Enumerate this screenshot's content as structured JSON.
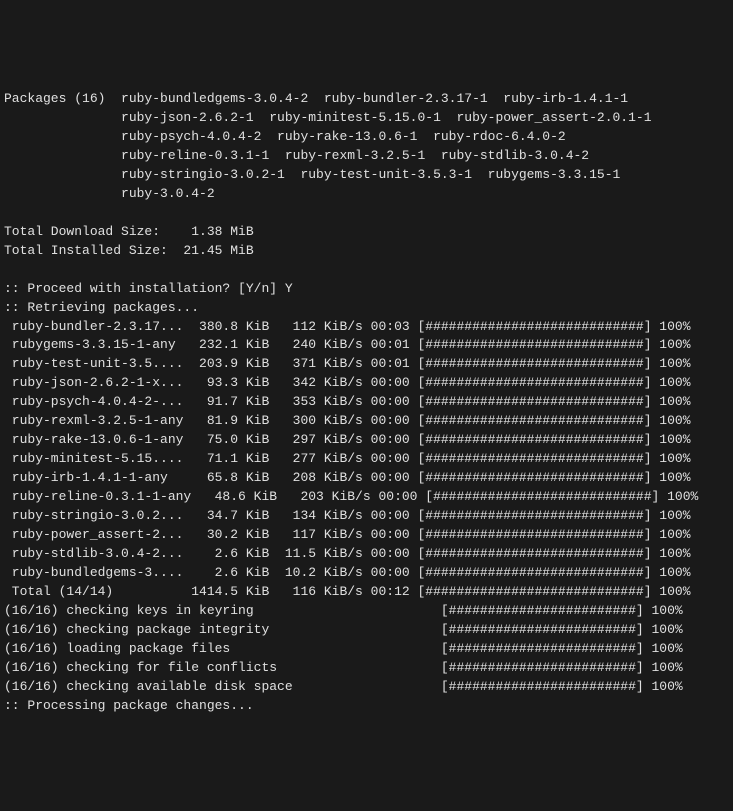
{
  "packages_header": "Packages (16)",
  "packages_wrapped": [
    "ruby-bundledgems-3.0.4-2  ruby-bundler-2.3.17-1  ruby-irb-1.4.1-1",
    "ruby-json-2.6.2-1  ruby-minitest-5.15.0-1  ruby-power_assert-2.0.1-1",
    "ruby-psych-4.0.4-2  ruby-rake-13.0.6-1  ruby-rdoc-6.4.0-2",
    "ruby-reline-0.3.1-1  ruby-rexml-3.2.5-1  ruby-stdlib-3.0.4-2",
    "ruby-stringio-3.0.2-1  ruby-test-unit-3.5.3-1  rubygems-3.3.15-1",
    "ruby-3.0.4-2"
  ],
  "total_download": "Total Download Size:    1.38 MiB",
  "total_installed": "Total Installed Size:  21.45 MiB",
  "proceed_prompt": ":: Proceed with installation? [Y/n] Y",
  "retrieving": ":: Retrieving packages...",
  "downloads": [
    {
      "name": "ruby-bundler-2.3.17...",
      "size": "380.8 KiB",
      "speed": "112 KiB/s",
      "time": "00:03",
      "pct": "100%"
    },
    {
      "name": "rubygems-3.3.15-1-any",
      "size": "232.1 KiB",
      "speed": "240 KiB/s",
      "time": "00:01",
      "pct": "100%"
    },
    {
      "name": "ruby-test-unit-3.5....",
      "size": "203.9 KiB",
      "speed": "371 KiB/s",
      "time": "00:01",
      "pct": "100%"
    },
    {
      "name": "ruby-json-2.6.2-1-x...",
      "size": "93.3 KiB",
      "speed": "342 KiB/s",
      "time": "00:00",
      "pct": "100%"
    },
    {
      "name": "ruby-psych-4.0.4-2-...",
      "size": "91.7 KiB",
      "speed": "353 KiB/s",
      "time": "00:00",
      "pct": "100%"
    },
    {
      "name": "ruby-rexml-3.2.5-1-any",
      "size": "81.9 KiB",
      "speed": "300 KiB/s",
      "time": "00:00",
      "pct": "100%"
    },
    {
      "name": "ruby-rake-13.0.6-1-any",
      "size": "75.0 KiB",
      "speed": "297 KiB/s",
      "time": "00:00",
      "pct": "100%"
    },
    {
      "name": "ruby-minitest-5.15....",
      "size": "71.1 KiB",
      "speed": "277 KiB/s",
      "time": "00:00",
      "pct": "100%"
    },
    {
      "name": "ruby-irb-1.4.1-1-any",
      "size": "65.8 KiB",
      "speed": "208 KiB/s",
      "time": "00:00",
      "pct": "100%"
    },
    {
      "name": "ruby-reline-0.3.1-1-any",
      "size": "48.6 KiB",
      "speed": "203 KiB/s",
      "time": "00:00",
      "pct": "100%"
    },
    {
      "name": "ruby-stringio-3.0.2...",
      "size": "34.7 KiB",
      "speed": "134 KiB/s",
      "time": "00:00",
      "pct": "100%"
    },
    {
      "name": "ruby-power_assert-2...",
      "size": "30.2 KiB",
      "speed": "117 KiB/s",
      "time": "00:00",
      "pct": "100%"
    },
    {
      "name": "ruby-stdlib-3.0.4-2...",
      "size": "2.6 KiB",
      "speed": "11.5 KiB/s",
      "time": "00:00",
      "pct": "100%"
    },
    {
      "name": "ruby-bundledgems-3....",
      "size": "2.6 KiB",
      "speed": "10.2 KiB/s",
      "time": "00:00",
      "pct": "100%"
    },
    {
      "name": "Total (14/14)",
      "size": "1414.5 KiB",
      "speed": "116 KiB/s",
      "time": "00:12",
      "pct": "100%"
    }
  ],
  "checks": [
    {
      "label": "(16/16) checking keys in keyring",
      "pct": "100%"
    },
    {
      "label": "(16/16) checking package integrity",
      "pct": "100%"
    },
    {
      "label": "(16/16) loading package files",
      "pct": "100%"
    },
    {
      "label": "(16/16) checking for file conflicts",
      "pct": "100%"
    },
    {
      "label": "(16/16) checking available disk space",
      "pct": "100%"
    }
  ],
  "processing": ":: Processing package changes...",
  "bar_full": "[############################]",
  "bar_short": "[########################]"
}
